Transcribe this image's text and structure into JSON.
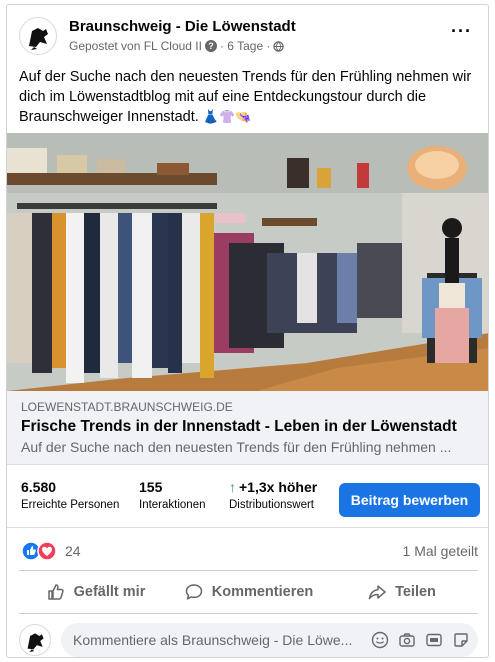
{
  "post": {
    "page_name": "Braunschweig - Die Löwenstadt",
    "meta_posted": "Gepostet von FL Cloud II",
    "meta_time": "· 6 Tage ·",
    "more_label": "···",
    "text": "Auf der Suche nach den neuesten Trends für den Frühling nehmen wir dich im Löwenstadtblog mit auf eine Entdeckungstour durch die Braunschweiger Innenstadt.",
    "text_emojis": "👗👚👒"
  },
  "link": {
    "domain": "LOEWENSTADT.BRAUNSCHWEIG.DE",
    "title": "Frische Trends in der Innenstadt - Leben in der Löwenstadt",
    "description": "Auf der Suche nach den neuesten Trends für den Frühling nehmen ..."
  },
  "insights": {
    "reach_value": "6.580",
    "reach_label": "Erreichte Personen",
    "interactions_value": "155",
    "interactions_label": "Interaktionen",
    "distribution_value": "+1,3x höher",
    "distribution_label": "Distributionswert",
    "boost_label": "Beitrag bewerben"
  },
  "reactions": {
    "count": "24",
    "shares": "1 Mal geteilt",
    "icons": [
      "like-icon",
      "love-icon"
    ]
  },
  "actions": {
    "like": "Gefällt mir",
    "comment": "Kommentieren",
    "share": "Teilen"
  },
  "comment": {
    "placeholder": "Kommentiere als Braunschweig - Die Löwe..."
  },
  "colors": {
    "accent": "#1b74e4",
    "positive": "#31a24c",
    "muted_text": "#65676b"
  }
}
